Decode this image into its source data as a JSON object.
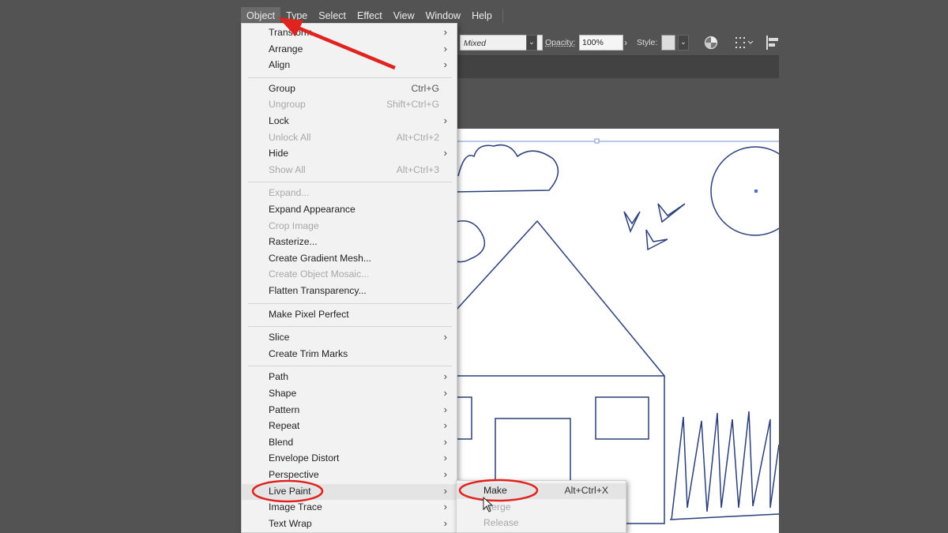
{
  "menubar": {
    "items": [
      {
        "label": "Object",
        "active": true
      },
      {
        "label": "Type"
      },
      {
        "label": "Select"
      },
      {
        "label": "Effect"
      },
      {
        "label": "View"
      },
      {
        "label": "Window"
      },
      {
        "label": "Help"
      }
    ]
  },
  "control_bar": {
    "blend_mode_value": "Mixed",
    "opacity_label": "Opacity:",
    "opacity_value": "100%",
    "style_label": "Style:"
  },
  "object_menu": {
    "sections": [
      [
        {
          "label": "Transform",
          "submenu": true
        },
        {
          "label": "Arrange",
          "submenu": true
        },
        {
          "label": "Align",
          "submenu": true
        }
      ],
      [
        {
          "label": "Group",
          "shortcut": "Ctrl+G"
        },
        {
          "label": "Ungroup",
          "shortcut": "Shift+Ctrl+G",
          "disabled": true
        },
        {
          "label": "Lock",
          "submenu": true
        },
        {
          "label": "Unlock All",
          "shortcut": "Alt+Ctrl+2",
          "disabled": true
        },
        {
          "label": "Hide",
          "submenu": true
        },
        {
          "label": "Show All",
          "shortcut": "Alt+Ctrl+3",
          "disabled": true
        }
      ],
      [
        {
          "label": "Expand...",
          "disabled": true
        },
        {
          "label": "Expand Appearance"
        },
        {
          "label": "Crop Image",
          "disabled": true
        },
        {
          "label": "Rasterize..."
        },
        {
          "label": "Create Gradient Mesh..."
        },
        {
          "label": "Create Object Mosaic...",
          "disabled": true
        },
        {
          "label": "Flatten Transparency..."
        }
      ],
      [
        {
          "label": "Make Pixel Perfect"
        }
      ],
      [
        {
          "label": "Slice",
          "submenu": true
        },
        {
          "label": "Create Trim Marks"
        }
      ],
      [
        {
          "label": "Path",
          "submenu": true
        },
        {
          "label": "Shape",
          "submenu": true
        },
        {
          "label": "Pattern",
          "submenu": true
        },
        {
          "label": "Repeat",
          "submenu": true
        },
        {
          "label": "Blend",
          "submenu": true
        },
        {
          "label": "Envelope Distort",
          "submenu": true
        },
        {
          "label": "Perspective",
          "submenu": true
        },
        {
          "label": "Live Paint",
          "submenu": true,
          "highlighted": true
        },
        {
          "label": "Image Trace",
          "submenu": true
        },
        {
          "label": "Text Wrap",
          "submenu": true
        }
      ]
    ]
  },
  "live_paint_submenu": {
    "items": [
      {
        "label": "Make",
        "shortcut": "Alt+Ctrl+X",
        "highlighted": true
      },
      {
        "label": "Merge",
        "disabled": true
      },
      {
        "label": "Release",
        "disabled": true
      }
    ]
  },
  "annotation_color": "#e0231f",
  "drawing_stroke_color": "#2b3f7a"
}
